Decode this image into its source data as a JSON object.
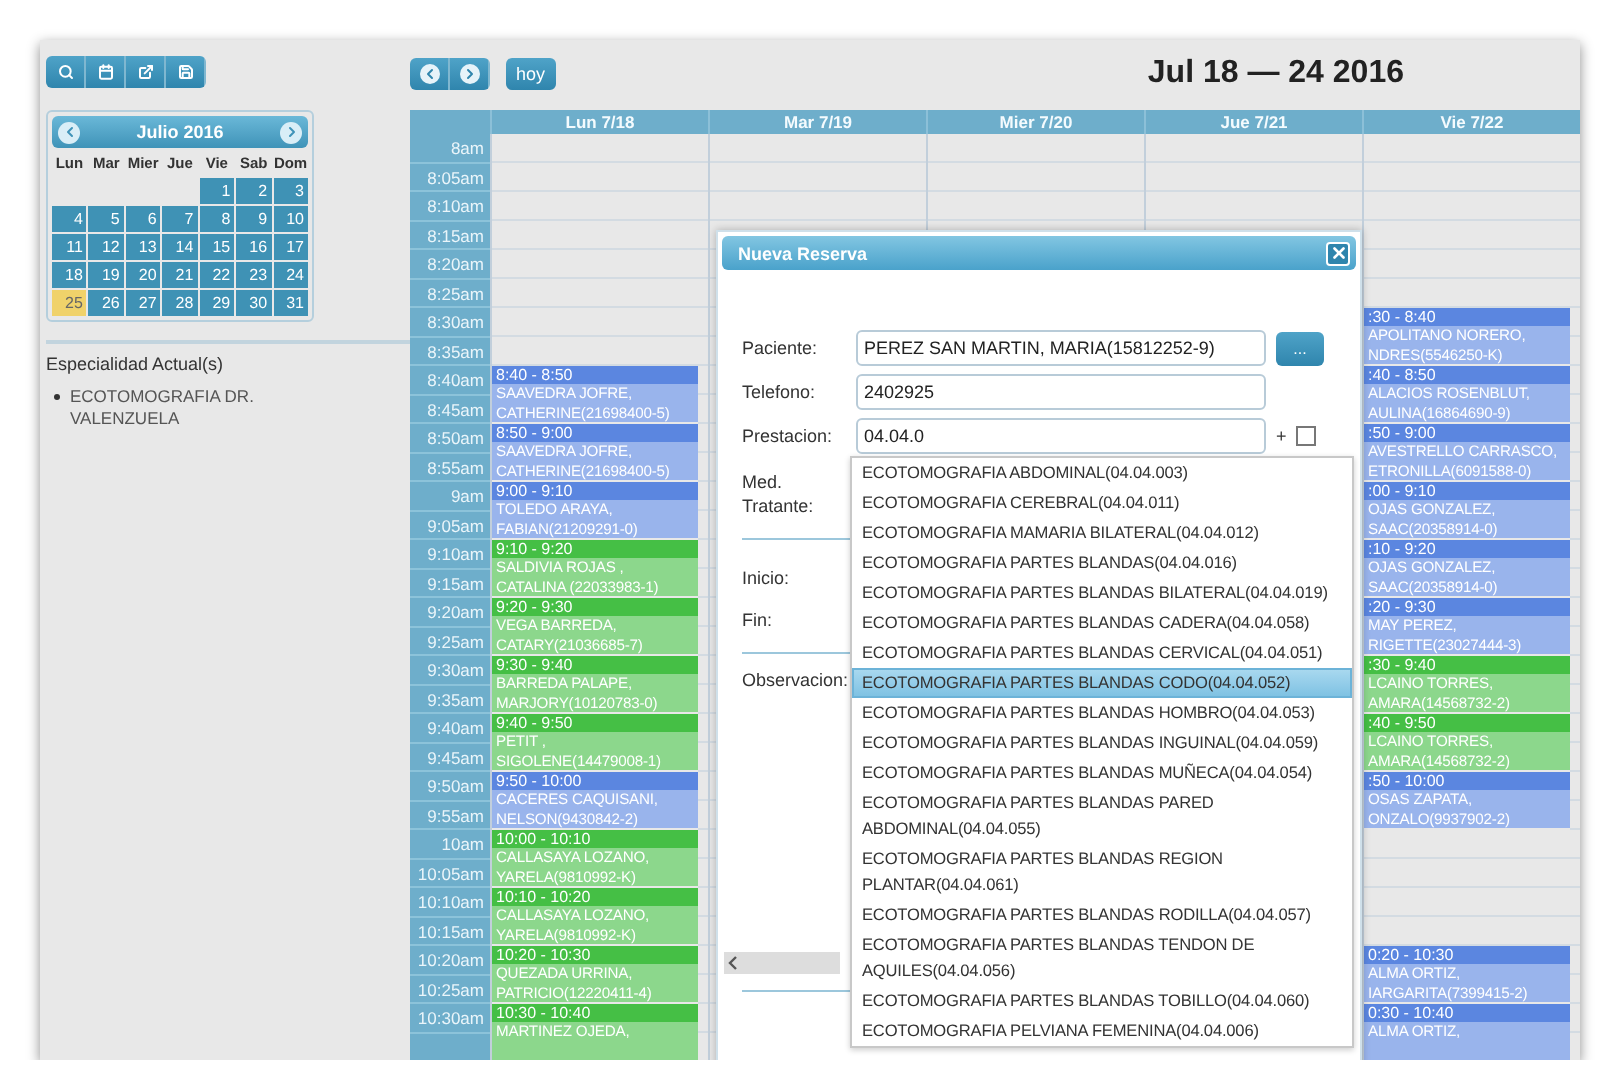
{
  "sidebar": {
    "mini_calendar": {
      "title": "Julio 2016",
      "weekdays": [
        "Lun",
        "Mar",
        "Mier",
        "Jue",
        "Vie",
        "Sab",
        "Dom"
      ],
      "weeks": [
        [
          {
            "label": "1",
            "selected": false
          },
          {
            "label": "2",
            "selected": false
          },
          {
            "label": "3",
            "selected": false
          }
        ],
        [
          {
            "label": "4",
            "selected": false
          },
          {
            "label": "5",
            "selected": false
          },
          {
            "label": "6",
            "selected": false
          },
          {
            "label": "7",
            "selected": false
          },
          {
            "label": "8",
            "selected": false
          },
          {
            "label": "9",
            "selected": false
          },
          {
            "label": "10",
            "selected": false
          }
        ],
        [
          {
            "label": "11",
            "selected": false
          },
          {
            "label": "12",
            "selected": false
          },
          {
            "label": "13",
            "selected": false
          },
          {
            "label": "14",
            "selected": false
          },
          {
            "label": "15",
            "selected": false
          },
          {
            "label": "16",
            "selected": false
          },
          {
            "label": "17",
            "selected": false
          }
        ],
        [
          {
            "label": "18",
            "selected": false
          },
          {
            "label": "19",
            "selected": false
          },
          {
            "label": "20",
            "selected": false
          },
          {
            "label": "21",
            "selected": false
          },
          {
            "label": "22",
            "selected": false
          },
          {
            "label": "23",
            "selected": false
          },
          {
            "label": "24",
            "selected": false
          }
        ],
        [
          {
            "label": "25",
            "selected": true
          },
          {
            "label": "26",
            "selected": false
          },
          {
            "label": "27",
            "selected": false
          },
          {
            "label": "28",
            "selected": false
          },
          {
            "label": "29",
            "selected": false
          },
          {
            "label": "30",
            "selected": false
          },
          {
            "label": "31",
            "selected": false
          }
        ]
      ]
    },
    "specialty": {
      "heading": "Especialidad Actual(s)",
      "items": [
        "ECOTOMOGRAFIA DR. VALENZUELA"
      ]
    }
  },
  "calendar": {
    "today_button": "hoy",
    "title": "Jul 18 — 24 2016",
    "times": [
      "8am",
      "8:05am",
      "8:10am",
      "8:15am",
      "8:20am",
      "8:25am",
      "8:30am",
      "8:35am",
      "8:40am",
      "8:45am",
      "8:50am",
      "8:55am",
      "9am",
      "9:05am",
      "9:10am",
      "9:15am",
      "9:20am",
      "9:25am",
      "9:30am",
      "9:35am",
      "9:40am",
      "9:45am",
      "9:50am",
      "9:55am",
      "10am",
      "10:05am",
      "10:10am",
      "10:15am",
      "10:20am",
      "10:25am",
      "10:30am"
    ],
    "days": [
      {
        "label": "Lun 7/18",
        "events": [
          {
            "time": "8:40 - 8:50",
            "lines": [
              "SAAVEDRA JOFRE,",
              "CATHERINE(21698400-5)"
            ],
            "color": "#5b86e0"
          },
          {
            "time": "8:50 - 9:00",
            "lines": [
              "SAAVEDRA JOFRE,",
              "CATHERINE(21698400-5)"
            ],
            "color": "#5b86e0"
          },
          {
            "time": "9:00 - 9:10",
            "lines": [
              "TOLEDO ARAYA,",
              "FABIAN(21209291-0)"
            ],
            "color": "#5b86e0"
          },
          {
            "time": "9:10 - 9:20",
            "lines": [
              "SALDIVIA ROJAS ,",
              "CATALINA (22033983-1)"
            ],
            "color": "#45bf45"
          },
          {
            "time": "9:20 - 9:30",
            "lines": [
              "VEGA BARREDA,",
              "CATARY(21036685-7)"
            ],
            "color": "#45bf45"
          },
          {
            "time": "9:30 - 9:40",
            "lines": [
              "BARREDA PALAPE,",
              "MARJORY(10120783-0)"
            ],
            "color": "#45bf45"
          },
          {
            "time": "9:40 - 9:50",
            "lines": [
              "PETIT ,",
              "SIGOLENE(14479008-1)"
            ],
            "color": "#45bf45"
          },
          {
            "time": "9:50 - 10:00",
            "lines": [
              "CACERES CAQUISANI,",
              "NELSON(9430842-2)"
            ],
            "color": "#5b86e0"
          },
          {
            "time": "10:00 - 10:10",
            "lines": [
              "CALLASAYA LOZANO,",
              "YARELA(9810992-K)"
            ],
            "color": "#45bf45"
          },
          {
            "time": "10:10 - 10:20",
            "lines": [
              "CALLASAYA LOZANO,",
              "YARELA(9810992-K)"
            ],
            "color": "#45bf45"
          },
          {
            "time": "10:20 - 10:30",
            "lines": [
              "QUEZADA URRINA,",
              "PATRICIO(12220411-4)"
            ],
            "color": "#45bf45"
          },
          {
            "time": "10:30 - 10:40",
            "lines": [
              "MARTINEZ OJEDA,"
            ],
            "color": "#45bf45"
          }
        ]
      },
      {
        "label": "Mar 7/19"
      },
      {
        "label": "Mier 7/20"
      },
      {
        "label": "Jue 7/21"
      },
      {
        "label": "Vie 7/22",
        "events": [
          {
            "time": ":30 - 8:40",
            "lines": [
              "APOLITANO NORERO,",
              "NDRES(5546250-K)"
            ],
            "color": "#5b86e0"
          },
          {
            "time": ":40 - 8:50",
            "lines": [
              "ALACIOS ROSENBLUT,",
              "AULINA(16864690-9)"
            ],
            "color": "#5b86e0"
          },
          {
            "time": ":50 - 9:00",
            "lines": [
              "AVESTRELLO CARRASCO,",
              "ETRONILLA(6091588-0)"
            ],
            "color": "#5b86e0"
          },
          {
            "time": ":00 - 9:10",
            "lines": [
              "OJAS GONZALEZ,",
              "SAAC(20358914-0)"
            ],
            "color": "#5b86e0"
          },
          {
            "time": ":10 - 9:20",
            "lines": [
              "OJAS GONZALEZ,",
              "SAAC(20358914-0)"
            ],
            "color": "#5b86e0"
          },
          {
            "time": ":20 - 9:30",
            "lines": [
              "MAY PEREZ,",
              "RIGETTE(23027444-3)"
            ],
            "color": "#5b86e0"
          },
          {
            "time": ":30 - 9:40",
            "lines": [
              "LCAINO TORRES,",
              "AMARA(14568732-2)"
            ],
            "color": "#45bf45"
          },
          {
            "time": ":40 - 9:50",
            "lines": [
              "LCAINO TORRES,",
              "AMARA(14568732-2)"
            ],
            "color": "#45bf45"
          },
          {
            "time": ":50 - 10:00",
            "lines": [
              "OSAS ZAPATA,",
              "ONZALO(9937902-2)"
            ],
            "color": "#5b86e0"
          },
          {
            "time": "0:20 - 10:30",
            "lines": [
              "ALMA ORTIZ,",
              "IARGARITA(7399415-2)"
            ],
            "color": "#5b86e0"
          },
          {
            "time": "0:30 - 10:40",
            "lines": [
              "ALMA ORTIZ,"
            ],
            "color": "#5b86e0"
          }
        ]
      }
    ]
  },
  "modal": {
    "title": "Nueva Reserva",
    "patient": {
      "label": "Paciente:",
      "value": "PEREZ SAN MARTIN, MARIA(15812252-9)",
      "button": "..."
    },
    "phone": {
      "label": "Telefono:",
      "value": "2402925"
    },
    "service": {
      "label": "Prestacion:",
      "value": "04.04.0",
      "plus": "+",
      "checked": false,
      "suggestions": [
        {
          "label": "ECOTOMOGRAFIA ABDOMINAL(04.04.003)",
          "selected": false
        },
        {
          "label": "ECOTOMOGRAFIA CEREBRAL(04.04.011)",
          "selected": false
        },
        {
          "label": "ECOTOMOGRAFIA MAMARIA BILATERAL(04.04.012)",
          "selected": false
        },
        {
          "label": "ECOTOMOGRAFIA PARTES BLANDAS(04.04.016)",
          "selected": false
        },
        {
          "label": "ECOTOMOGRAFIA PARTES BLANDAS BILATERAL(04.04.019)",
          "selected": false
        },
        {
          "label": "ECOTOMOGRAFIA PARTES BLANDAS CADERA(04.04.058)",
          "selected": false
        },
        {
          "label": "ECOTOMOGRAFIA PARTES BLANDAS CERVICAL(04.04.051)",
          "selected": false
        },
        {
          "label": "ECOTOMOGRAFIA PARTES BLANDAS CODO(04.04.052)",
          "selected": true
        },
        {
          "label": "ECOTOMOGRAFIA PARTES BLANDAS HOMBRO(04.04.053)",
          "selected": false
        },
        {
          "label": "ECOTOMOGRAFIA PARTES BLANDAS INGUINAL(04.04.059)",
          "selected": false
        },
        {
          "label": "ECOTOMOGRAFIA PARTES BLANDAS MUÑECA(04.04.054)",
          "selected": false
        },
        {
          "label": "ECOTOMOGRAFIA PARTES BLANDAS PARED ABDOMINAL(04.04.055)",
          "selected": false
        },
        {
          "label": "ECOTOMOGRAFIA PARTES BLANDAS REGION PLANTAR(04.04.061)",
          "selected": false
        },
        {
          "label": "ECOTOMOGRAFIA PARTES BLANDAS RODILLA(04.04.057)",
          "selected": false
        },
        {
          "label": "ECOTOMOGRAFIA PARTES BLANDAS TENDON DE AQUILES(04.04.056)",
          "selected": false
        },
        {
          "label": "ECOTOMOGRAFIA PARTES BLANDAS TOBILLO(04.04.060)",
          "selected": false
        },
        {
          "label": "ECOTOMOGRAFIA PELVIANA FEMENINA(04.04.006)",
          "selected": false
        }
      ]
    },
    "doctor": {
      "label": "Med. Tratante:"
    },
    "start": {
      "label": "Inicio:"
    },
    "end": {
      "label": "Fin:"
    },
    "notes": {
      "label": "Observacion:"
    }
  }
}
